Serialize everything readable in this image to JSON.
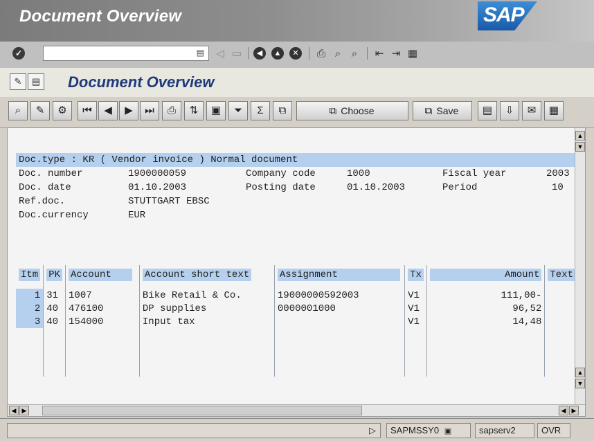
{
  "window": {
    "title": "Document Overview",
    "logo": "SAP"
  },
  "command_bar": {
    "field_value": "",
    "icons": [
      "ok-icon",
      "history-icon",
      "back-arrow-icon",
      "save-icon",
      "back-icon",
      "exit-icon",
      "cancel-icon",
      "print-icon",
      "find-icon",
      "find-next-icon",
      "first-page-icon",
      "next-page-icon",
      "layout-icon"
    ]
  },
  "screen": {
    "title": "Document Overview"
  },
  "app_toolbar": {
    "choose_label": "Choose",
    "save_label": "Save"
  },
  "header": {
    "doc_type_line": "Doc.type : KR ( Vendor invoice ) Normal document",
    "doc_number_label": "Doc. number",
    "doc_number": "1900000059",
    "company_code_label": "Company code",
    "company_code": "1000",
    "fiscal_year_label": "Fiscal year",
    "fiscal_year": "2003",
    "doc_date_label": "Doc. date",
    "doc_date": "01.10.2003",
    "posting_date_label": "Posting date",
    "posting_date": "01.10.2003",
    "period_label": "Period",
    "period": "10",
    "ref_doc_label": "Ref.doc.",
    "ref_doc": "STUTTGART EBSC",
    "currency_label": "Doc.currency",
    "currency": "EUR"
  },
  "table": {
    "columns": [
      "Itm",
      "PK",
      "Account",
      "Account short text",
      "Assignment",
      "Tx",
      "Amount",
      "Text"
    ],
    "rows": [
      {
        "itm": "1",
        "pk": "31",
        "account": "1007",
        "short_text": "Bike Retail & Co.",
        "assignment": "19000000592003",
        "tx": "V1",
        "amount": "111,00-",
        "text": ""
      },
      {
        "itm": "2",
        "pk": "40",
        "account": "476100",
        "short_text": "DP supplies",
        "assignment": "0000001000",
        "tx": "V1",
        "amount": "96,52",
        "text": ""
      },
      {
        "itm": "3",
        "pk": "40",
        "account": "154000",
        "short_text": "Input tax",
        "assignment": "",
        "tx": "V1",
        "amount": "14,48",
        "text": ""
      }
    ]
  },
  "status_bar": {
    "program": "SAPMSSY0",
    "server": "sapserv2",
    "mode": "OVR"
  }
}
